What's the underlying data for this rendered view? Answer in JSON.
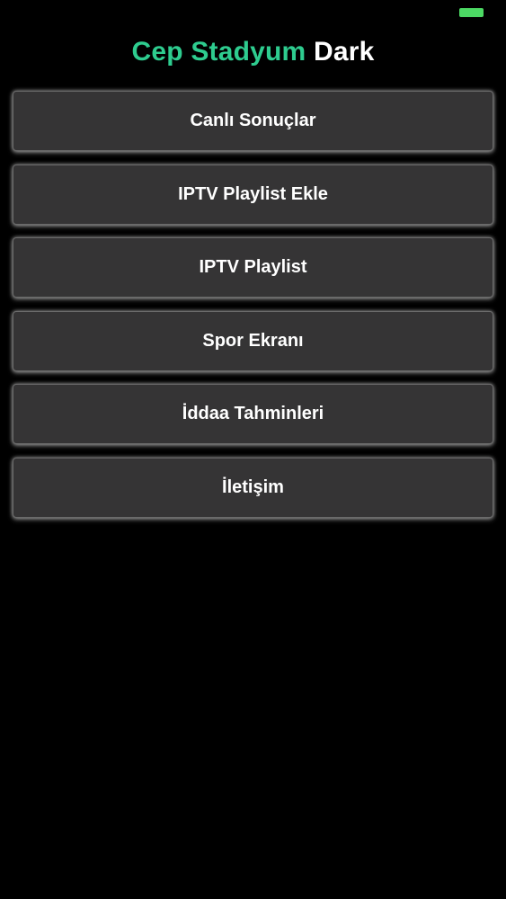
{
  "status_bar": {
    "battery_icon": "battery-icon",
    "battery_color": "#4cd964"
  },
  "header": {
    "title_brand": "Cep Stadyum",
    "title_suffix": "Dark",
    "brand_color": "#2ecc8f"
  },
  "menu": {
    "items": [
      {
        "label": "Canlı Sonuçlar"
      },
      {
        "label": "IPTV Playlist Ekle"
      },
      {
        "label": "IPTV Playlist"
      },
      {
        "label": "Spor Ekranı"
      },
      {
        "label": "İddaa Tahminleri"
      },
      {
        "label": "İletişim"
      }
    ]
  }
}
